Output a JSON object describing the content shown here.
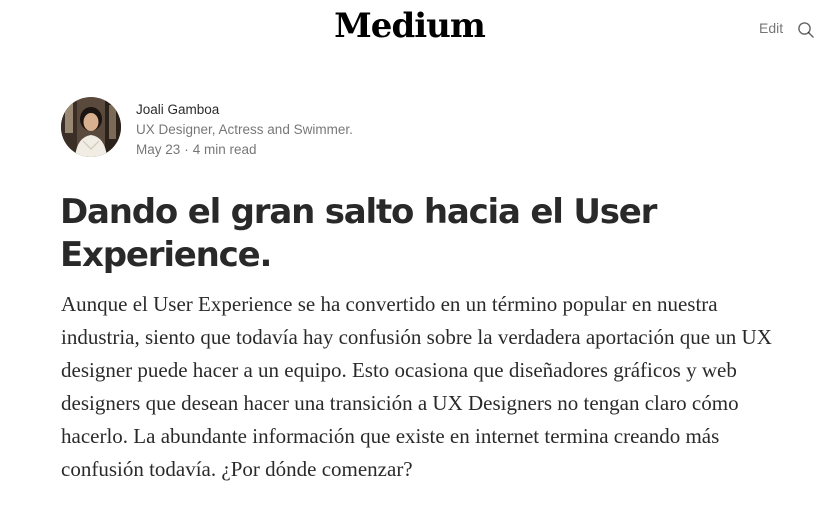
{
  "header": {
    "logo": "Medium",
    "edit_label": "Edit",
    "search_icon": "search-icon"
  },
  "author": {
    "name": "Joali Gamboa",
    "bio": "UX Designer, Actress and Swimmer.",
    "date": "May 23",
    "separator": "·",
    "read_time": "4 min read"
  },
  "article": {
    "title": "Dando el gran salto hacia el User Experience.",
    "lead": "Aunque el User Experience se ha convertido en un término popular en nuestra industria, siento que todavía hay confusión sobre la verdadera aportación que un UX designer puede hacer a un equipo. Esto ocasiona que diseñadores gráficos y web designers que desean hacer una transición a UX Designers no tengan claro cómo hacerlo. La abundante información que existe en internet termina creando más confusión todavía. ¿Por dónde comenzar?"
  },
  "colors": {
    "text_primary": "#000000d6",
    "text_secondary": "#0000008a",
    "background": "#ffffff"
  }
}
